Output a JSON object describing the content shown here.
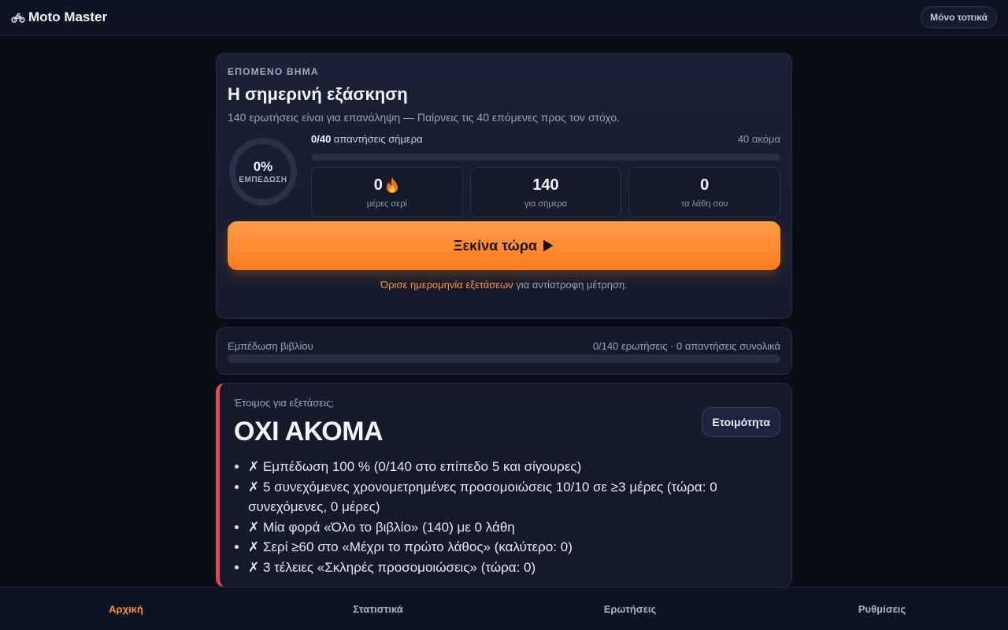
{
  "topbar": {
    "brand_icon": "motorcycle-icon",
    "brand": "Moto Master",
    "local_only": "Μόνο τοπικά"
  },
  "hero": {
    "eyebrow": "ΕΠΟΜΕΝΟ ΒΗΜΑ",
    "title": "Η σημερινή εξάσκηση",
    "subtitle": "140 ερωτήσεις είναι για επανάληψη — Παίρνεις τις 40 επόμενες προς τον στόχο.",
    "ring_pct": "0%",
    "ring_label": "ΕΜΠΕΔΩΣΗ",
    "answers_count": "0/40",
    "answers_text": " απαντήσεις σήμερα",
    "answers_more": "40 ακόμα",
    "today_progress": 0,
    "stats": [
      {
        "value": "0",
        "icon": "fire-icon",
        "label": "μέρες σερί"
      },
      {
        "value": "140",
        "label": "για σήμερα"
      },
      {
        "value": "0",
        "label": "τα λάθη σου"
      }
    ],
    "start_label": "Ξεκίνα τώρα",
    "start_icon": "play-icon",
    "exam_link": "Όρισε ημερομηνία εξετάσεων",
    "exam_rest": " για αντίστροφη μέτρηση."
  },
  "book": {
    "label": "Εμπέδωση βιβλίου",
    "summary": "0/140 ερωτήσεις · 0 απαντήσεις συνολικά",
    "progress": 0
  },
  "readiness": {
    "question": "Έτοιμος για εξετάσεις;",
    "status": "ΟΧΙ ΑΚΟΜΑ",
    "button": "Ετοιμότητα",
    "accent_color": "#e04a5a",
    "criteria": [
      "✗ Εμπέδωση 100 % (0/140 στο επίπεδο 5 και σίγουρες)",
      "✗ 5 συνεχόμενες χρονομετρημένες προσομοιώσεις 10/10 σε ≥3 μέρες (τώρα: 0 συνεχόμενες, 0 μέρες)",
      "✗ Μία φορά «Όλο το βιβλίο» (140) με 0 λάθη",
      "✗ Σερί ≥60 στο «Μέχρι το πρώτο λάθος» (καλύτερο: 0)",
      "✗ 3 τέλειες «Σκληρές προσομοιώσεις» (τώρα: 0)"
    ]
  },
  "nav": {
    "active_color": "#ff8a36",
    "items": [
      "Αρχική",
      "Στατιστικά",
      "Ερωτήσεις",
      "Ρυθμίσεις"
    ]
  }
}
